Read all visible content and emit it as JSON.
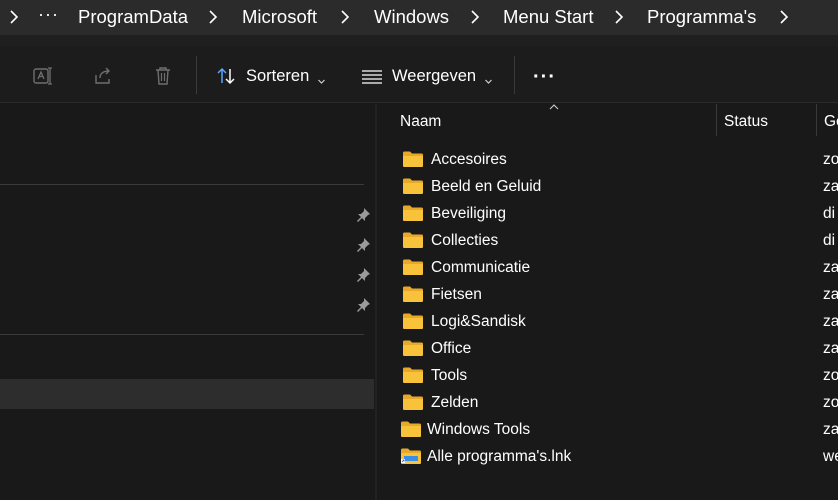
{
  "address_bar": {
    "overflow": "···",
    "crumbs": [
      "ProgramData",
      "Microsoft",
      "Windows",
      "Menu Start",
      "Programma's"
    ]
  },
  "toolbar": {
    "sort_label": "Sorteren",
    "view_label": "Weergeven",
    "more_label": "···"
  },
  "columns": {
    "name": "Naam",
    "status": "Status",
    "date": "Ge"
  },
  "files": [
    {
      "name": "Accesoires",
      "type": "folder",
      "date_fragment": "zo"
    },
    {
      "name": "Beeld en Geluid",
      "type": "folder",
      "date_fragment": "za"
    },
    {
      "name": "Beveiliging",
      "type": "folder",
      "date_fragment": "di"
    },
    {
      "name": "Collecties",
      "type": "folder",
      "date_fragment": "di"
    },
    {
      "name": "Communicatie",
      "type": "folder",
      "date_fragment": "za"
    },
    {
      "name": "Fietsen",
      "type": "folder",
      "date_fragment": "za"
    },
    {
      "name": "Logi&Sandisk",
      "type": "folder",
      "date_fragment": "za"
    },
    {
      "name": "Office",
      "type": "folder",
      "date_fragment": "za"
    },
    {
      "name": "Tools",
      "type": "folder",
      "date_fragment": "zo"
    },
    {
      "name": "Zelden",
      "type": "folder",
      "date_fragment": "zo"
    },
    {
      "name": "Windows Tools",
      "type": "folder",
      "date_fragment": "za"
    },
    {
      "name": "Alle programma's.lnk",
      "type": "shortcut",
      "date_fragment": "we"
    }
  ],
  "colors": {
    "background": "#191919",
    "address_bar": "#2b2b2b",
    "folder_yellow": "#f8c33a",
    "accent_blue": "#5aa7ff"
  }
}
